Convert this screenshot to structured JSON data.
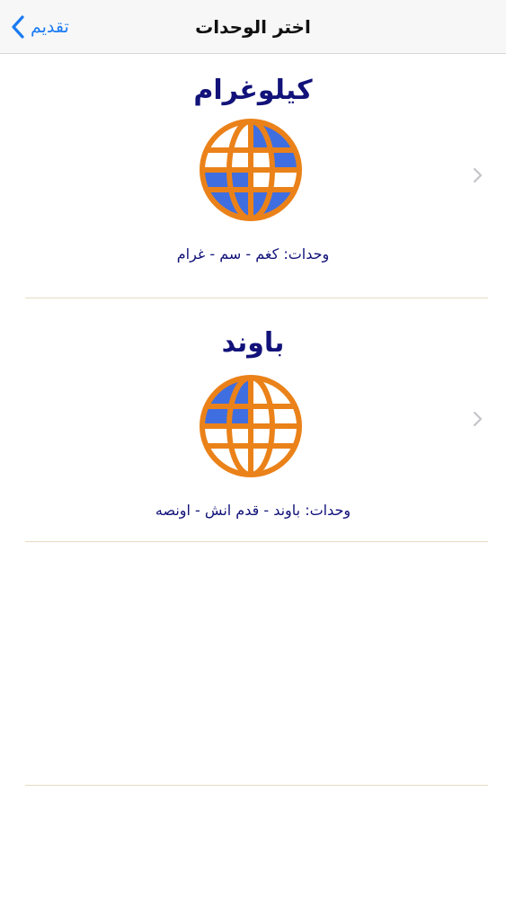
{
  "navbar": {
    "back_label": "تقديم",
    "title": "اختر الوحدات"
  },
  "rows": [
    {
      "title": "كيلوغرام",
      "units": "وحدات: كغم - سم - غرام"
    },
    {
      "title": "باوند",
      "units": "وحدات: باوند - قدم انش - اونصه"
    }
  ],
  "colors": {
    "accent": "#1a7bf2",
    "text_navy": "#12127a",
    "globe_orange": "#ea8219",
    "globe_blue": "#3f6ee0",
    "separator": "#e6dcc0"
  },
  "icons": {
    "back": "chevron-left-icon",
    "globe": "globe-icon",
    "disclosure": "chevron-right-icon"
  }
}
